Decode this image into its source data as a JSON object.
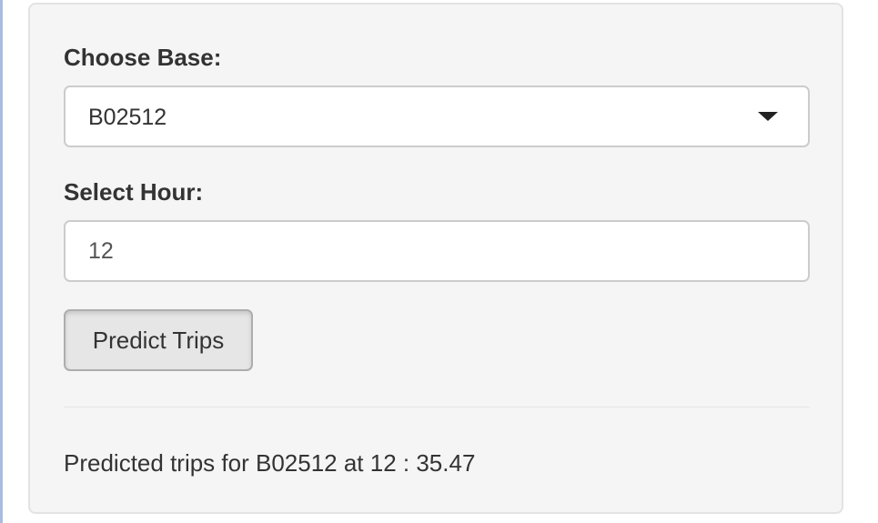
{
  "base_field": {
    "label": "Choose Base:",
    "selected_value": "B02512",
    "icon": "caret-down-icon"
  },
  "hour_field": {
    "label": "Select Hour:",
    "value": "12"
  },
  "predict_button": {
    "label": "Predict Trips"
  },
  "result": {
    "text": "Predicted trips for B02512 at 12 : 35.47"
  },
  "colors": {
    "panel_background": "#f5f5f5",
    "panel_border": "#e3e3e3",
    "button_background": "#e6e6e6",
    "text": "#333333"
  }
}
